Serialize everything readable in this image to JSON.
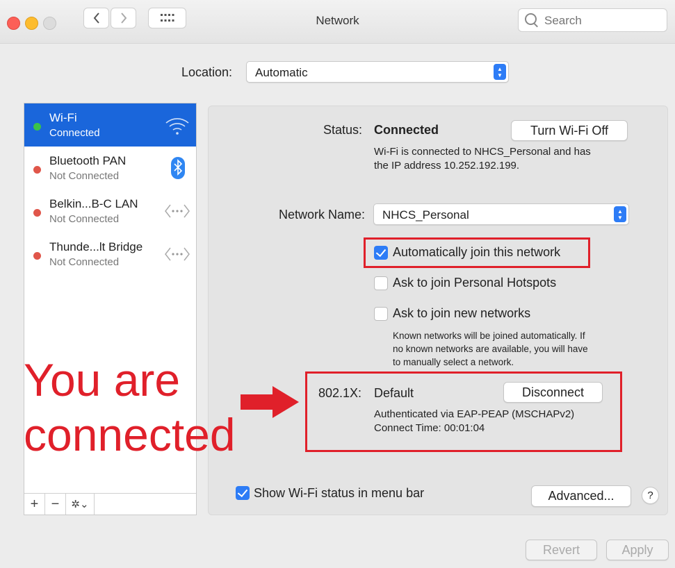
{
  "window": {
    "title": "Network"
  },
  "search": {
    "placeholder": "Search"
  },
  "location": {
    "label": "Location:",
    "value": "Automatic"
  },
  "services": [
    {
      "name": "Wi-Fi",
      "status": "Connected",
      "selected": true,
      "dot_color": "#3bc24a",
      "icon": "wifi-icon"
    },
    {
      "name": "Bluetooth PAN",
      "status": "Not Connected",
      "selected": false,
      "dot_color": "#e0564a",
      "icon": "bluetooth-icon"
    },
    {
      "name": "Belkin...B-C LAN",
      "status": "Not Connected",
      "selected": false,
      "dot_color": "#e0564a",
      "icon": "ethernet-icon"
    },
    {
      "name": "Thunde...lt Bridge",
      "status": "Not Connected",
      "selected": false,
      "dot_color": "#e0564a",
      "icon": "ethernet-icon"
    }
  ],
  "sidebar_tools": {
    "add": "+",
    "remove": "−",
    "gear": "✲⌄"
  },
  "status": {
    "label": "Status:",
    "value": "Connected",
    "description_line1": "Wi-Fi is connected to NHCS_Personal and has",
    "description_line2": "the IP address 10.252.192.199.",
    "turn_off_label": "Turn Wi-Fi Off"
  },
  "network_name": {
    "label": "Network Name:",
    "value": "NHCS_Personal"
  },
  "options": {
    "auto_join": {
      "label": "Automatically join this network",
      "checked": true
    },
    "personal_hotspots": {
      "label": "Ask to join Personal Hotspots",
      "checked": false
    },
    "new_networks": {
      "label": "Ask to join new networks",
      "checked": false
    },
    "note_line1": "Known networks will be joined automatically. If",
    "note_line2": "no known networks are available, you will have",
    "note_line3": "to manually select a network."
  },
  "dot1x": {
    "label": "802.1X:",
    "value": "Default",
    "disconnect_label": "Disconnect",
    "auth": "Authenticated via EAP-PEAP (MSCHAPv2)",
    "connect_time": "Connect Time: 00:01:04"
  },
  "show_status": {
    "label": "Show Wi-Fi status in menu bar",
    "checked": true
  },
  "buttons": {
    "advanced": "Advanced...",
    "help": "?",
    "revert": "Revert",
    "apply": "Apply"
  },
  "annotation": {
    "line1": "You are",
    "line2": "connected"
  },
  "colors": {
    "accent": "#2d7cf6",
    "selection": "#1a66db",
    "annotation": "#e0202a"
  }
}
